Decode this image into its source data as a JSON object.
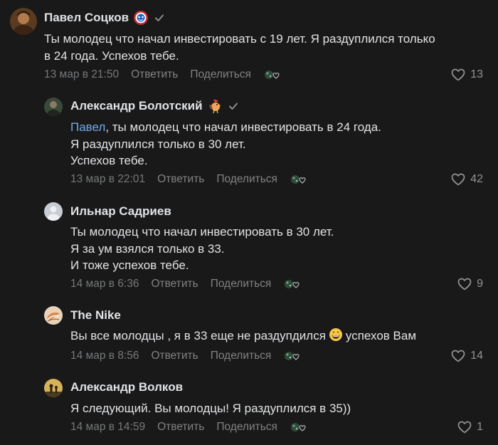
{
  "comments": [
    {
      "author": "Павел Соцков",
      "lines": [
        "Ты молодец что начал инвестировать с 19 лет. Я раздуплился только",
        "в 24 года. Успехов тебе."
      ],
      "date": "13 мар в 21:50",
      "reply_label": "Ответить",
      "share_label": "Поделиться",
      "likes": "13"
    },
    {
      "author": "Александр Болотский",
      "mention": "Павел",
      "line1_rest": ", ты молодец что начал инвестировать в 24 года.",
      "lines": [
        "Я раздуплился только в 30 лет.",
        "Успехов тебе."
      ],
      "date": "13 мар в 22:01",
      "reply_label": "Ответить",
      "share_label": "Поделиться",
      "likes": "42"
    },
    {
      "author": "Ильнар Садриев",
      "lines": [
        "Ты молодец что начал инвестировать в 30 лет.",
        "Я за ум взялся только в 33.",
        "И тоже успехов тебе."
      ],
      "date": "14 мар в 6:36",
      "reply_label": "Ответить",
      "share_label": "Поделиться",
      "likes": "9"
    },
    {
      "author": "The Nike",
      "text_before": "Вы все молодцы , я в 33 еще не раздупдился",
      "text_after": "успехов Вам",
      "date": "14 мар в 8:56",
      "reply_label": "Ответить",
      "share_label": "Поделиться",
      "likes": "14"
    },
    {
      "author": "Александр Волков",
      "lines": [
        "Я следующий. Вы молодцы! Я раздуплился в 35))"
      ],
      "date": "14 мар в 14:59",
      "reply_label": "Ответить",
      "share_label": "Поделиться",
      "likes": "1"
    }
  ],
  "icons": {
    "like": "heart-outline-icon",
    "react": "reaction-icon",
    "verified": "check-icon",
    "badge_captain": "captain-shield-icon",
    "badge_rooster": "rooster-icon",
    "emoji": "grinning-face-icon"
  },
  "colors": {
    "background": "#191919",
    "text": "#e1e3e6",
    "meta": "#76787a",
    "mention": "#71aaeb"
  }
}
